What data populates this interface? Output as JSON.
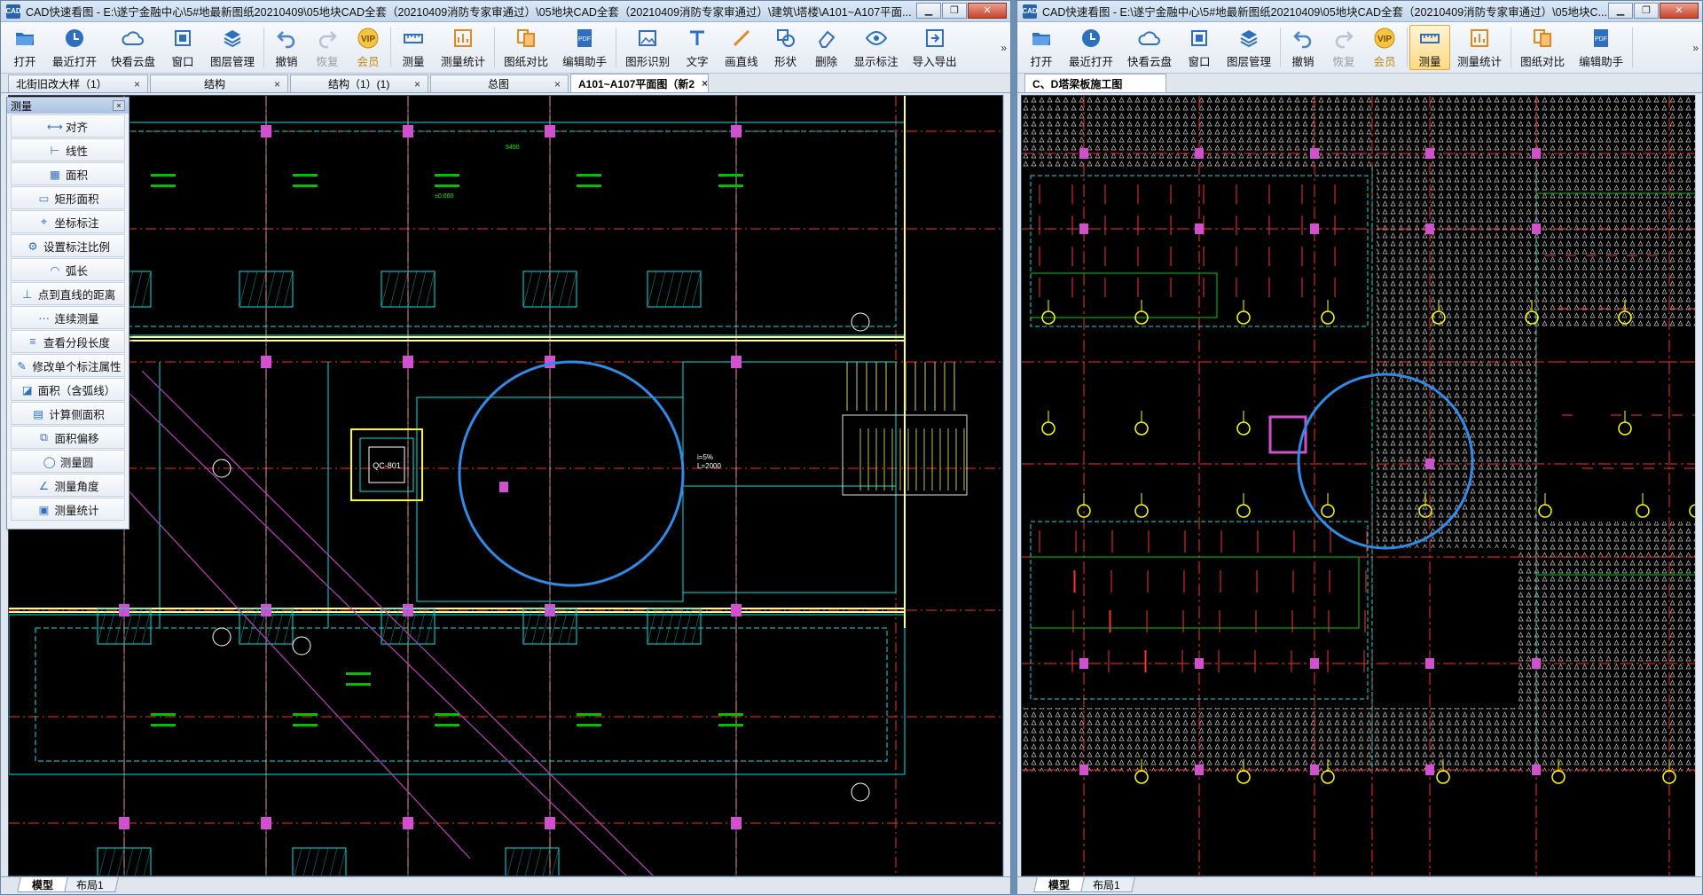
{
  "left_window": {
    "title": "CAD快速看图 - E:\\遂宁金融中心\\5#地最新图纸20210409\\05地块CAD全套（20210409消防专家审通过）\\05地块CAD全套（20210409消防专家审通过）\\建筑\\塔楼\\A101~A107平面...",
    "toolbar": [
      "打开",
      "最近打开",
      "快看云盘",
      "窗口",
      "图层管理",
      "撤销",
      "恢复",
      "会员",
      "测量",
      "测量统计",
      "图纸对比",
      "编辑助手",
      "图形识别",
      "文字",
      "画直线",
      "形状",
      "删除",
      "显示标注",
      "导入导出"
    ],
    "more": "»",
    "tabs": [
      {
        "label": "北街旧改大样（1）",
        "active": false
      },
      {
        "label": "结构",
        "active": false
      },
      {
        "label": "结构（1）(1)",
        "active": false
      },
      {
        "label": "总图",
        "active": false
      },
      {
        "label": "A101~A107平面图（新2",
        "active": true
      }
    ],
    "layout_tabs": [
      "模型",
      "布局1"
    ],
    "measure_panel": {
      "title": "测量",
      "close": "×",
      "items": [
        "对齐",
        "线性",
        "面积",
        "矩形面积",
        "坐标标注",
        "设置标注比例",
        "弧长",
        "点到直线的距离",
        "连续测量",
        "查看分段长度",
        "修改单个标注属性",
        "面积（含弧线）",
        "计算侧面积",
        "面积偏移",
        "测量圆",
        "测量角度",
        "测量统计"
      ]
    },
    "drawing_labels": {
      "elevator": "QC-801",
      "ramp_slope": "i=5%",
      "ramp_length": "L=2000",
      "dim": "5450",
      "elev": "±0.000"
    }
  },
  "right_window": {
    "title": "CAD快速看图 - E:\\遂宁金融中心\\5#地最新图纸20210409\\05地块CAD全套（20210409消防专家审通过）\\05地块C...",
    "toolbar": [
      "打开",
      "最近打开",
      "快看云盘",
      "窗口",
      "图层管理",
      "撤销",
      "恢复",
      "会员",
      "测量",
      "测量统计",
      "图纸对比",
      "编辑助手"
    ],
    "more": "»",
    "active_toolbar": "测量",
    "tabs": [
      {
        "label": "C、D塔梁板施工图",
        "active": true
      }
    ],
    "layout_tabs": [
      "模型",
      "布局1"
    ]
  },
  "colors": {
    "canvas_bg": "#000000",
    "axis_red": "#ff2a2a",
    "cyan": "#00e5e5",
    "green": "#00d000",
    "yellow": "#ffff00",
    "white": "#ffffff",
    "magenta": "#d050d0",
    "circle_blue": "#2f8be8"
  },
  "icons": {
    "open": "folder-open-icon",
    "recent": "clock-icon",
    "cloud": "cloud-icon",
    "window": "window-icon",
    "layers": "layers-icon",
    "undo": "undo-icon",
    "redo": "redo-icon",
    "vip": "vip-icon",
    "measure": "ruler-icon",
    "measure_stats": "stats-icon",
    "compare": "compare-icon",
    "edit_helper": "pdf-icon",
    "recognize": "image-icon",
    "text": "text-icon",
    "line": "line-icon",
    "shape": "shape-icon",
    "delete": "eraser-icon",
    "show_dim": "eye-icon",
    "import_export": "import-icon"
  }
}
